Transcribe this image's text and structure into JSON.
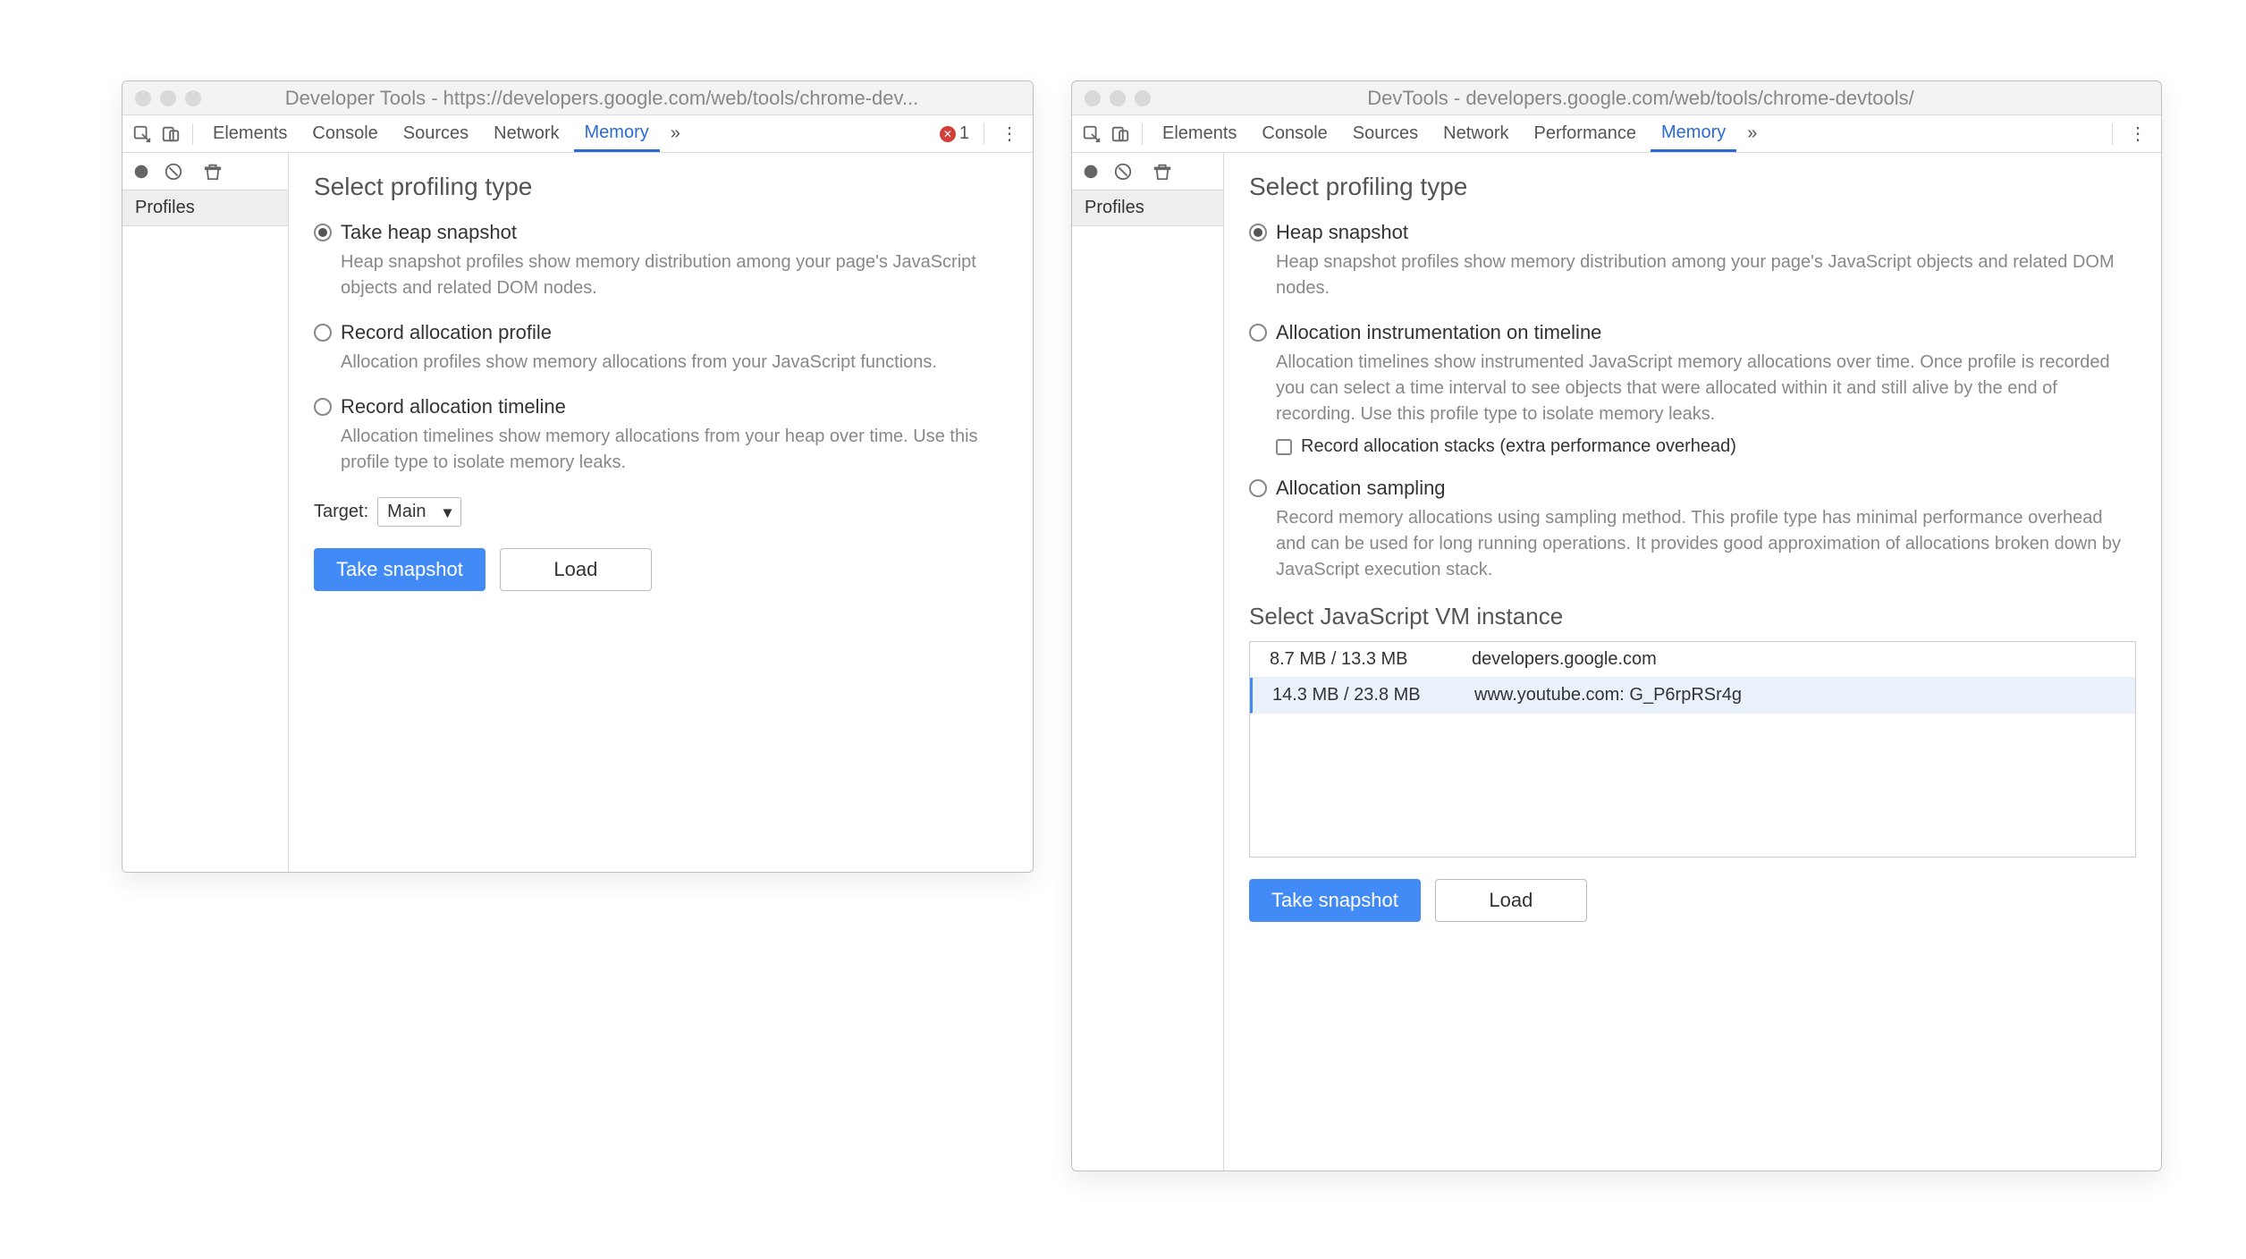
{
  "left": {
    "title": "Developer Tools - https://developers.google.com/web/tools/chrome-dev...",
    "tabs": [
      "Elements",
      "Console",
      "Sources",
      "Network",
      "Memory"
    ],
    "activeTab": "Memory",
    "errorCount": "1",
    "sidebarHeading": "Profiles",
    "heading": "Select profiling type",
    "options": [
      {
        "label": "Take heap snapshot",
        "desc": "Heap snapshot profiles show memory distribution among your page's JavaScript objects and related DOM nodes.",
        "checked": true
      },
      {
        "label": "Record allocation profile",
        "desc": "Allocation profiles show memory allocations from your JavaScript functions.",
        "checked": false
      },
      {
        "label": "Record allocation timeline",
        "desc": "Allocation timelines show memory allocations from your heap over time. Use this profile type to isolate memory leaks.",
        "checked": false
      }
    ],
    "targetLabel": "Target:",
    "targetValue": "Main",
    "primaryBtn": "Take snapshot",
    "secondaryBtn": "Load"
  },
  "right": {
    "title": "DevTools - developers.google.com/web/tools/chrome-devtools/",
    "tabs": [
      "Elements",
      "Console",
      "Sources",
      "Network",
      "Performance",
      "Memory"
    ],
    "activeTab": "Memory",
    "sidebarHeading": "Profiles",
    "heading": "Select profiling type",
    "options": [
      {
        "label": "Heap snapshot",
        "desc": "Heap snapshot profiles show memory distribution among your page's JavaScript objects and related DOM nodes.",
        "checked": true
      },
      {
        "label": "Allocation instrumentation on timeline",
        "desc": "Allocation timelines show instrumented JavaScript memory allocations over time. Once profile is recorded you can select a time interval to see objects that were allocated within it and still alive by the end of recording. Use this profile type to isolate memory leaks.",
        "checked": false,
        "checkboxLabel": "Record allocation stacks (extra performance overhead)"
      },
      {
        "label": "Allocation sampling",
        "desc": "Record memory allocations using sampling method. This profile type has minimal performance overhead and can be used for long running operations. It provides good approximation of allocations broken down by JavaScript execution stack.",
        "checked": false
      }
    ],
    "vmHeading": "Select JavaScript VM instance",
    "vmRows": [
      {
        "size": "8.7 MB / 13.3 MB",
        "name": "developers.google.com",
        "selected": false
      },
      {
        "size": "14.3 MB / 23.8 MB",
        "name": "www.youtube.com: G_P6rpRSr4g",
        "selected": true
      }
    ],
    "primaryBtn": "Take snapshot",
    "secondaryBtn": "Load"
  }
}
